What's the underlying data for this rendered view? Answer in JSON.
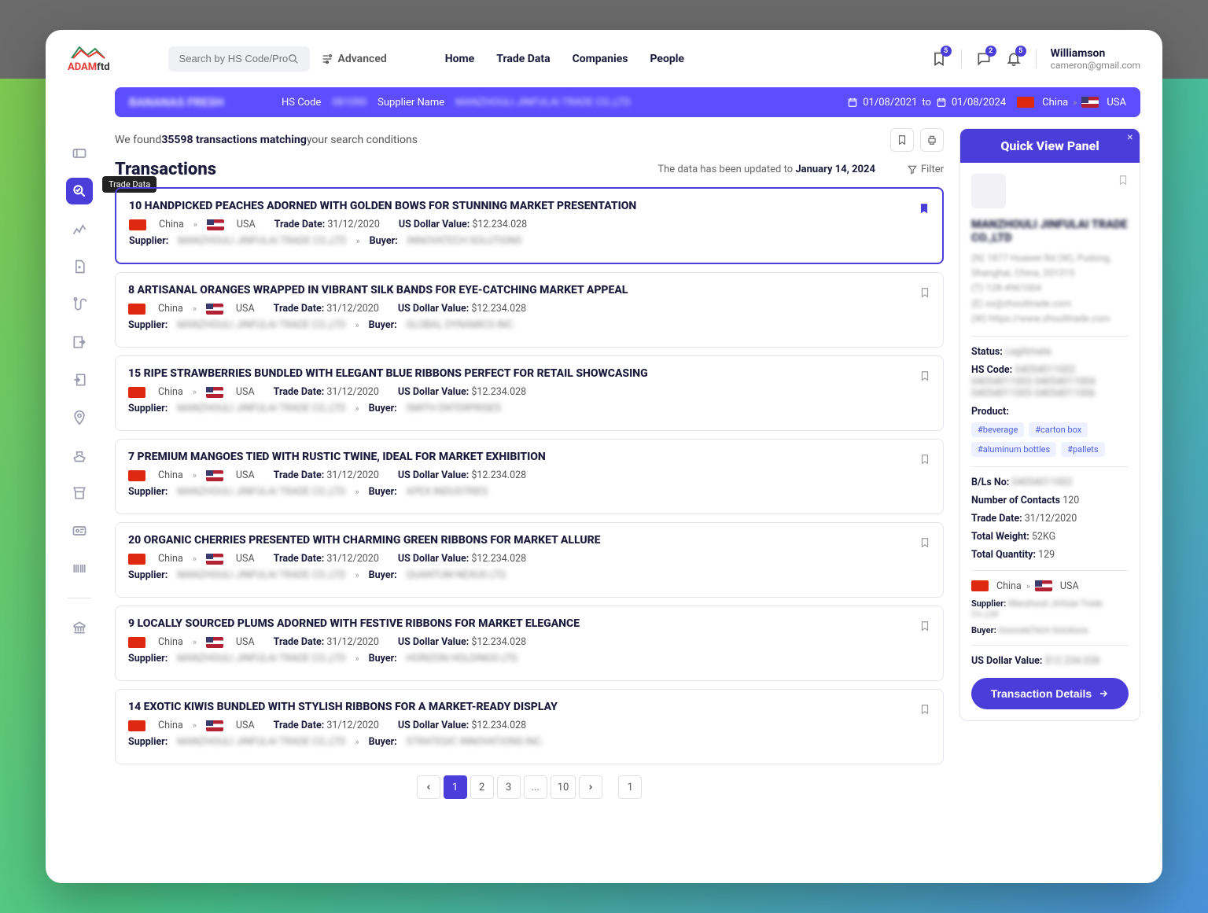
{
  "logo": {
    "text": "ADAM",
    "suffix": "ftd"
  },
  "search": {
    "placeholder": "Search by HS Code/Product"
  },
  "advanced": "Advanced",
  "nav": [
    "Home",
    "Trade Data",
    "Companies",
    "People"
  ],
  "badges": {
    "bookmark": "5",
    "chat": "2",
    "bell": "5"
  },
  "user": {
    "name": "Williamson",
    "email": "cameron@gmail.com"
  },
  "side_tooltip": "Trade Data",
  "filterbar": {
    "product": "BANANAS FRESH",
    "hs_label": "HS Code",
    "hs_value": "081090",
    "supplier_label": "Supplier Name",
    "supplier_value": "MANZHOULI JINFULAI TRADE CO.,LTD",
    "date_from": "01/08/2021",
    "date_to": "01/08/2024",
    "date_sep": "to",
    "from": "China",
    "to_country": "USA"
  },
  "found": {
    "pre": "We found ",
    "count": "35598 transactions matching",
    "post": " your search conditions"
  },
  "transactions_title": "Transactions",
  "update": {
    "pre": "The data has been updated to ",
    "date": "January 14, 2024"
  },
  "filter_label": "Filter",
  "cards": [
    {
      "title": "10 HANDPICKED PEACHES ADORNED WITH GOLDEN BOWS FOR STUNNING MARKET PRESENTATION",
      "from": "China",
      "to": "USA",
      "td_label": "Trade Date:",
      "td": "31/12/2020",
      "val_label": "US Dollar Value:",
      "val": "$12.234.028",
      "sup_label": "Supplier:",
      "sup": "MANZHOULI JINFULAI TRADE CO.,LTD",
      "buy_label": "Buyer:",
      "buy": "INNOVATECH SOLUTIONS",
      "selected": true
    },
    {
      "title": "8 ARTISANAL ORANGES WRAPPED IN VIBRANT SILK BANDS FOR EYE-CATCHING MARKET APPEAL",
      "from": "China",
      "to": "USA",
      "td_label": "Trade Date:",
      "td": "31/12/2020",
      "val_label": "US Dollar Value:",
      "val": "$12.234.028",
      "sup_label": "Supplier:",
      "sup": "MANZHOULI JINFULAI TRADE CO.,LTD",
      "buy_label": "Buyer:",
      "buy": "GLOBAL DYNAMICS INC."
    },
    {
      "title": "15 RIPE STRAWBERRIES BUNDLED WITH ELEGANT BLUE RIBBONS PERFECT FOR RETAIL SHOWCASING",
      "from": "China",
      "to": "USA",
      "td_label": "Trade Date:",
      "td": "31/12/2020",
      "val_label": "US Dollar Value:",
      "val": "$12.234.028",
      "sup_label": "Supplier:",
      "sup": "MANZHOULI JINFULAI TRADE CO.,LTD",
      "buy_label": "Buyer:",
      "buy": "SMITH ENTERPRISES"
    },
    {
      "title": "7 PREMIUM MANGOES TIED WITH RUSTIC TWINE, IDEAL FOR MARKET EXHIBITION",
      "from": "China",
      "to": "USA",
      "td_label": "Trade Date:",
      "td": "31/12/2020",
      "val_label": "US Dollar Value:",
      "val": "$12.234.028",
      "sup_label": "Supplier:",
      "sup": "MANZHOULI JINFULAI TRADE CO.,LTD",
      "buy_label": "Buyer:",
      "buy": "APEX INDUSTRIES"
    },
    {
      "title": "20 ORGANIC CHERRIES PRESENTED WITH CHARMING GREEN RIBBONS FOR MARKET ALLURE",
      "from": "China",
      "to": "USA",
      "td_label": "Trade Date:",
      "td": "31/12/2020",
      "val_label": "US Dollar Value:",
      "val": "$12.234.028",
      "sup_label": "Supplier:",
      "sup": "MANZHOULI JINFULAI TRADE CO.,LTD",
      "buy_label": "Buyer:",
      "buy": "QUANTUM NEXUS LTD."
    },
    {
      "title": "9 LOCALLY SOURCED PLUMS ADORNED WITH FESTIVE RIBBONS FOR MARKET ELEGANCE",
      "from": "China",
      "to": "USA",
      "td_label": "Trade Date:",
      "td": "31/12/2020",
      "val_label": "US Dollar Value:",
      "val": "$12.234.028",
      "sup_label": "Supplier:",
      "sup": "MANZHOULI JINFULAI TRADE CO.,LTD",
      "buy_label": "Buyer:",
      "buy": "HORIZON HOLDINGS LTD."
    },
    {
      "title": "14 EXOTIC KIWIS BUNDLED WITH STYLISH RIBBONS FOR A MARKET-READY DISPLAY",
      "from": "China",
      "to": "USA",
      "td_label": "Trade Date:",
      "td": "31/12/2020",
      "val_label": "US Dollar Value:",
      "val": "$12.234.028",
      "sup_label": "Supplier:",
      "sup": "MANZHOULI JINFULAI TRADE CO.,LTD",
      "buy_label": "Buyer:",
      "buy": "STRATEGIC INNOVATIONS INC."
    }
  ],
  "pagination": {
    "pages": [
      "1",
      "2",
      "3",
      "...",
      "10"
    ],
    "far": "1"
  },
  "panel": {
    "title": "Quick View Panel",
    "company": "MANZHOULI JINFULAI TRADE CO.,LTD",
    "address": "(N) 1877 Huawei Rd (W), Pudong, Shanghai, China, 201315",
    "phone": "(T) 128-4961004",
    "email": "(E) xx@zhoulitrade.com",
    "web": "(W) https://www.zhoulitrade.com",
    "status_label": "Status:",
    "status": "Legitimate",
    "hs_label": "HS Code:",
    "hs": "04054011002  04054011003  04054011004  04054011005  04054011006",
    "product_label": "Product:",
    "tags": [
      "#beverage",
      "#carton box",
      "#aluminum bottles",
      "#pallets"
    ],
    "bls_label": "B/Ls No:",
    "bls": "04054011002",
    "contacts_label": "Number of Contacts",
    "contacts": "120",
    "td_label": "Trade Date:",
    "td": "31/12/2020",
    "weight_label": "Total Weight:",
    "weight": "52KG",
    "qty_label": "Total Quantity:",
    "qty": "129",
    "from": "China",
    "to": "USA",
    "sup_label": "Supplier:",
    "sup": "Manzhouli Jinfulai Trade Co.,Ltd",
    "buy_label": "Buyer:",
    "buy": "InnovateTech Solutions",
    "val_label": "US Dollar Value:",
    "val": "$12.234.028",
    "btn": "Transaction Details"
  }
}
